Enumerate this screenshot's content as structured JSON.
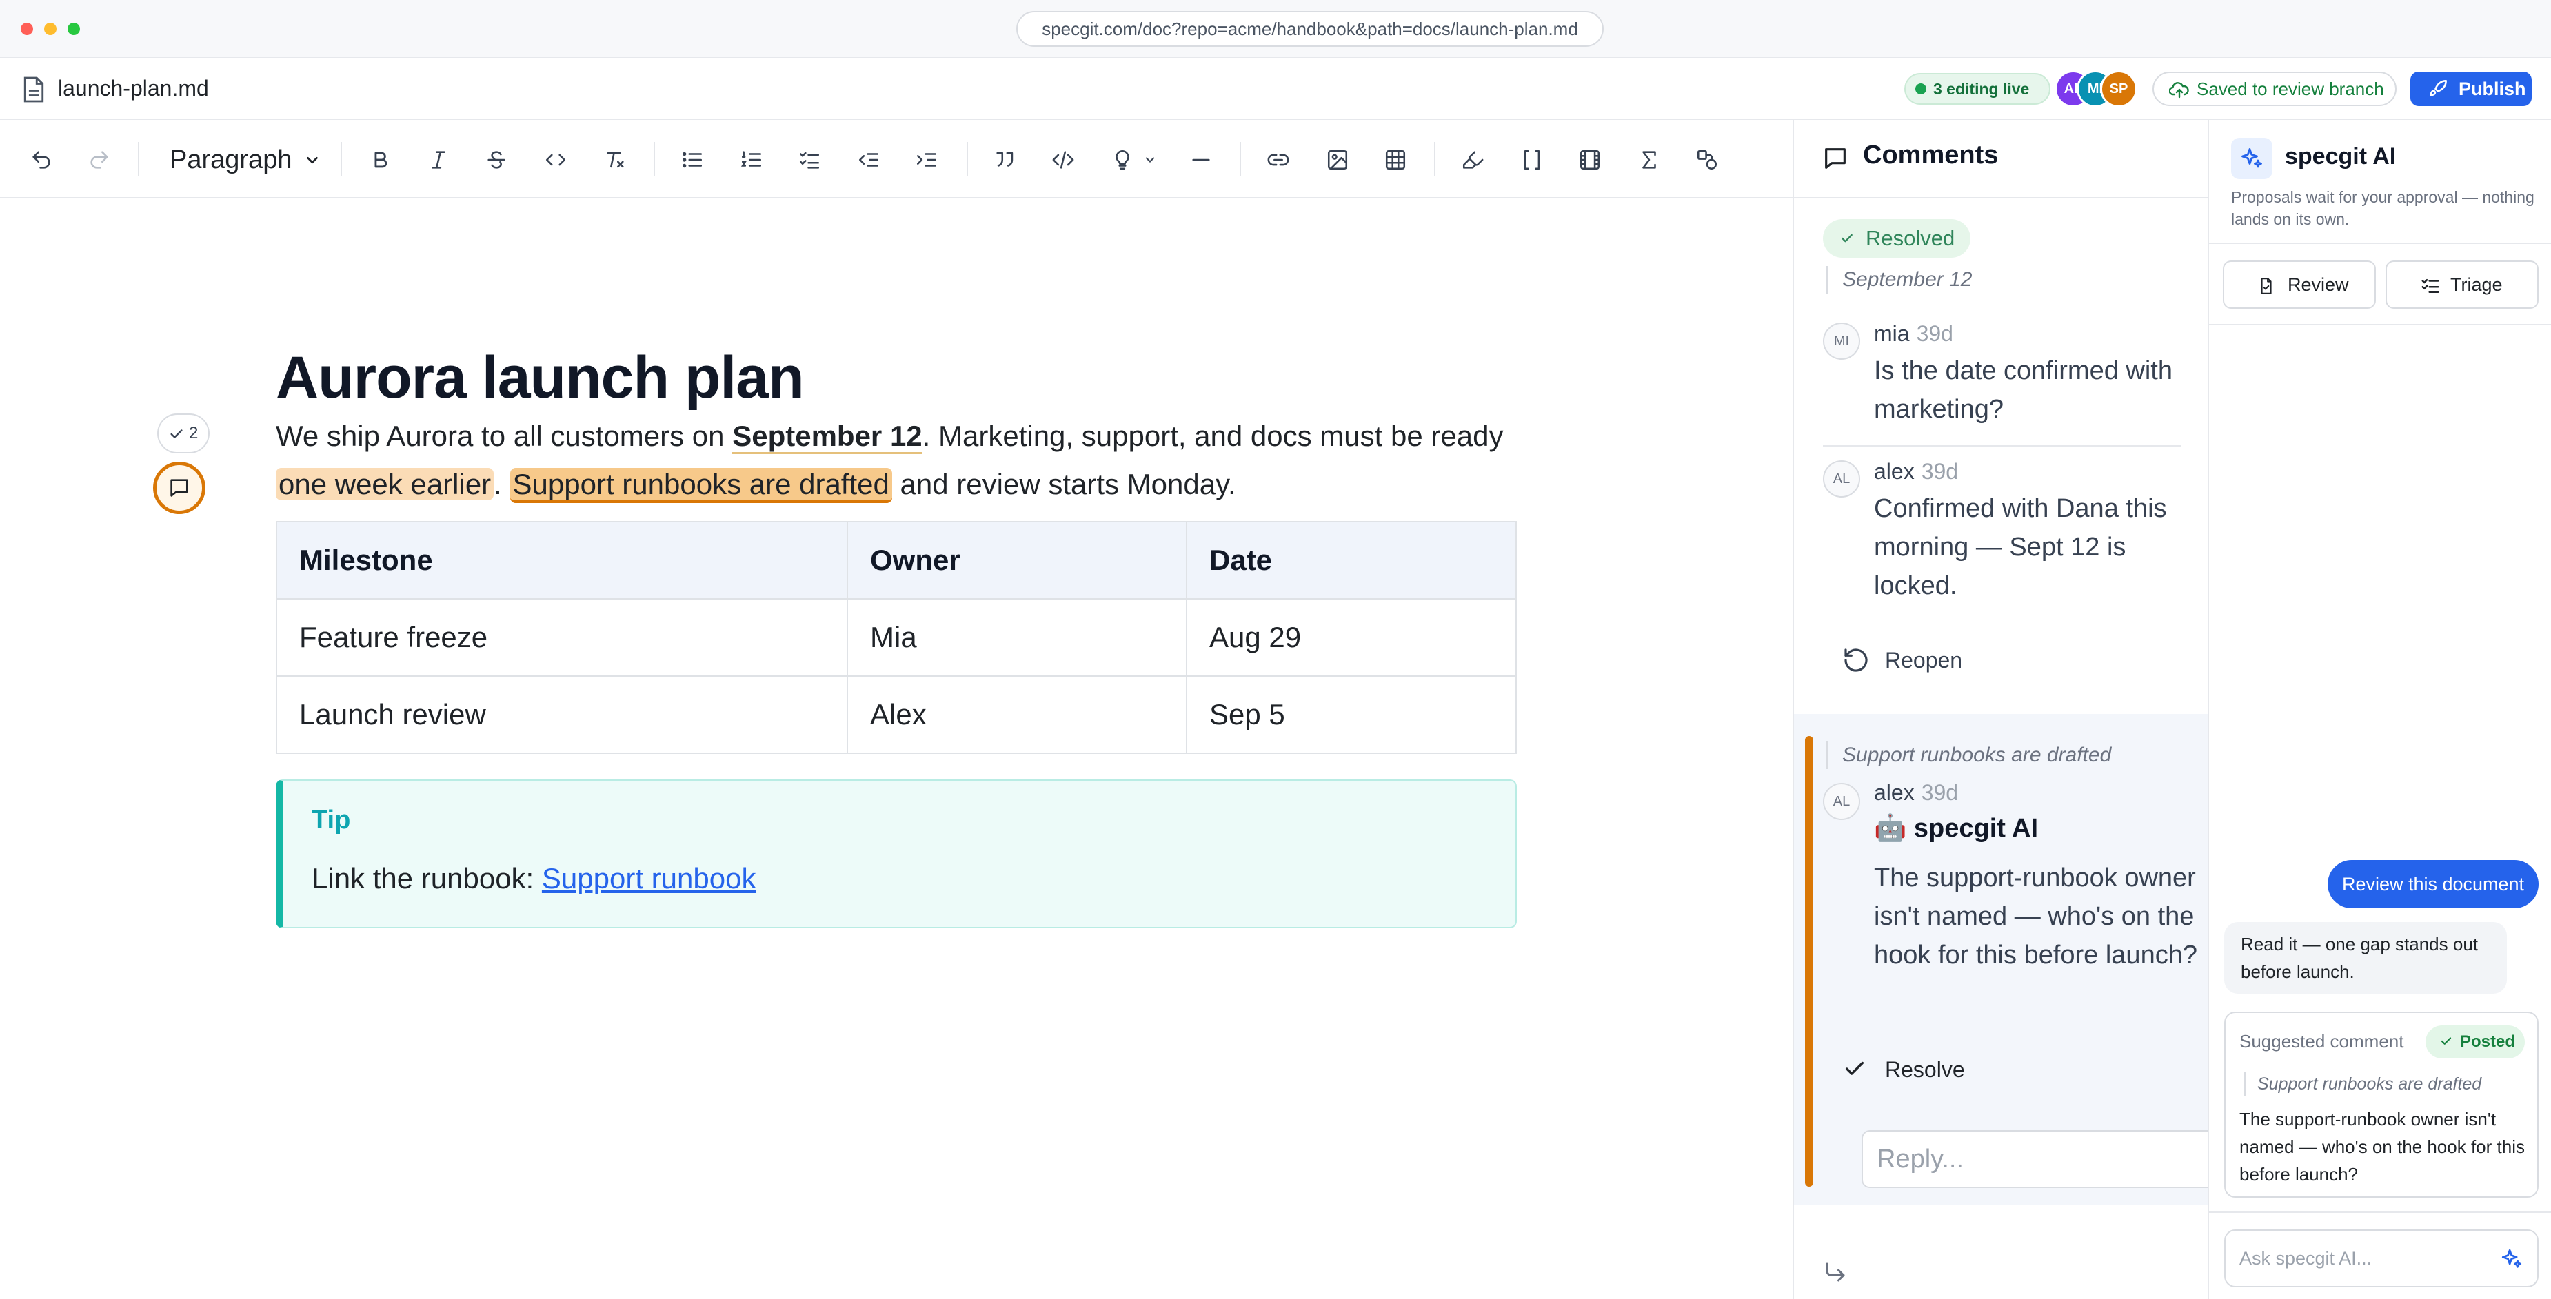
{
  "browser": {
    "url": "specgit.com/doc?repo=acme/handbook&path=docs/launch-plan.md"
  },
  "header": {
    "filename": "launch-plan.md",
    "live_status": "3 editing live",
    "avatars": [
      {
        "initials": "AL",
        "color": "#7c3aed"
      },
      {
        "initials": "MI",
        "color": "#0891b2"
      },
      {
        "initials": "SP",
        "color": "#d97706"
      }
    ],
    "saved_label": "Saved to review branch",
    "publish_label": "Publish"
  },
  "toolbar": {
    "block_type": "Paragraph",
    "icons": [
      "undo-icon",
      "redo-icon",
      "bold-icon",
      "italic-icon",
      "strikethrough-icon",
      "inline-code-icon",
      "clear-format-icon",
      "bullet-list-icon",
      "numbered-list-icon",
      "task-list-icon",
      "outdent-icon",
      "indent-icon",
      "blockquote-icon",
      "code-block-icon",
      "callout-icon",
      "horizontal-rule-icon",
      "link-icon",
      "image-icon",
      "table-icon",
      "highlighter-icon",
      "brackets-icon",
      "film-icon",
      "sigma-icon",
      "shapes-icon"
    ]
  },
  "document": {
    "title": "Aurora launch plan",
    "para": {
      "t1": "We ship Aurora to all customers on ",
      "bold": "September 12",
      "t2": ". Marketing, support, and docs must be ready ",
      "hl1": "one week earlier",
      "t3": ". ",
      "hl2": "Support runbooks are drafted",
      "t4": " and review starts Monday."
    },
    "resolved_count": "2",
    "table": {
      "headers": [
        "Milestone",
        "Owner",
        "Date"
      ],
      "rows": [
        [
          "Feature freeze",
          "Mia",
          "Aug 29"
        ],
        [
          "Launch review",
          "Alex",
          "Sep 5"
        ]
      ]
    },
    "tip": {
      "label": "Tip",
      "text": "Link the runbook: ",
      "link": "Support runbook"
    }
  },
  "comments": {
    "title": "Comments",
    "thread1": {
      "status": "Resolved",
      "quote": "September 12",
      "items": [
        {
          "avatar": "MI",
          "author": "mia",
          "age": "39d",
          "text": "Is the date confirmed with marketing?"
        },
        {
          "avatar": "AL",
          "author": "alex",
          "age": "39d",
          "text": "Confirmed with Dana this morning — Sept 12 is locked."
        }
      ],
      "action": "Reopen"
    },
    "thread2": {
      "quote": "Support runbooks are drafted",
      "item": {
        "avatar": "AL",
        "author": "alex",
        "age": "39d",
        "ai_label": "🤖 specgit AI",
        "text": "The support-runbook owner isn't named — who's on the hook for this before launch?"
      },
      "action": "Resolve",
      "reply_placeholder": "Reply..."
    }
  },
  "ai_panel": {
    "title": "specgit AI",
    "subtitle": "Proposals wait for your approval — nothing lands on its own.",
    "tabs": [
      "Review",
      "Triage"
    ],
    "user_message": "Review this document",
    "bot_message": "Read it — one gap stands out before launch.",
    "suggestion": {
      "label": "Suggested comment",
      "status": "Posted",
      "quote": "Support runbooks are drafted",
      "text": "The support-runbook owner isn't named — who's on the hook for this before launch?"
    },
    "ask_placeholder": "Ask specgit AI..."
  }
}
